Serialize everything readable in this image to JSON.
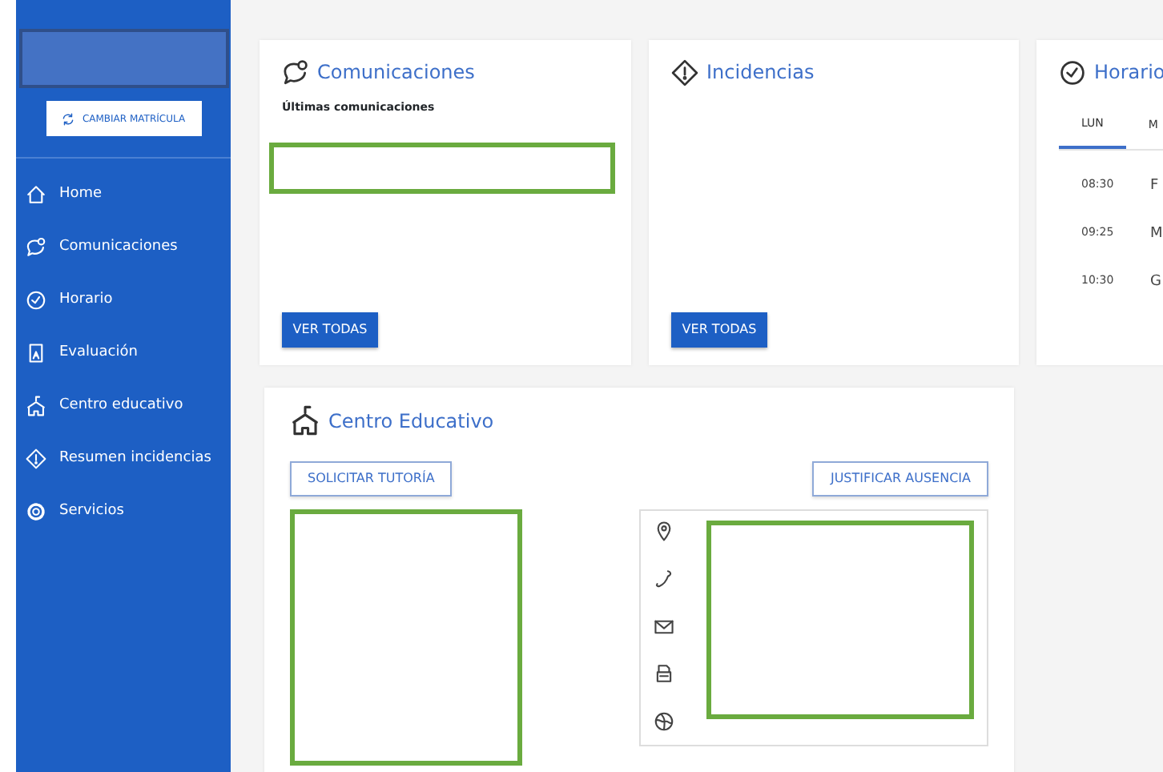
{
  "sidebar": {
    "switch_button": "CAMBIAR MATRÍCULA",
    "items": [
      {
        "label": "Home"
      },
      {
        "label": "Comunicaciones"
      },
      {
        "label": "Horario"
      },
      {
        "label": "Evaluación"
      },
      {
        "label": "Centro educativo"
      },
      {
        "label": "Resumen incidencias"
      },
      {
        "label": "Servicios"
      }
    ]
  },
  "comunicaciones": {
    "title": "Comunicaciones",
    "subtitle": "Últimas comunicaciones",
    "button": "VER TODAS"
  },
  "incidencias": {
    "title": "Incidencias",
    "button": "VER TODAS"
  },
  "horario": {
    "title": "Horario",
    "tabs": [
      {
        "label": "LUN",
        "selected": true
      },
      {
        "label": "M",
        "selected": false
      }
    ],
    "rows": [
      {
        "time": "08:30",
        "subject": "F"
      },
      {
        "time": "09:25",
        "subject": "M"
      },
      {
        "time": "10:30",
        "subject": "G"
      }
    ]
  },
  "centro": {
    "title": "Centro Educativo",
    "left_button": "SOLICITAR TUTORÍA",
    "right_button": "JUSTIFICAR AUSENCIA"
  }
}
